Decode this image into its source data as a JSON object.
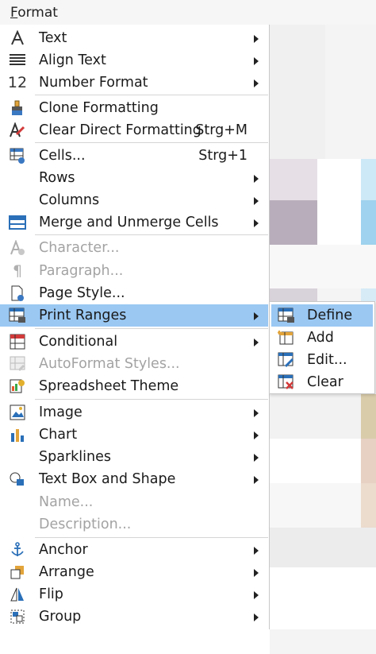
{
  "menubar": {
    "title": "Format",
    "mnemonic_first": "F",
    "mnemonic_rest": "ormat"
  },
  "menu": {
    "items": [
      {
        "label": "Text",
        "icon": "text-A-icon",
        "arrow": true
      },
      {
        "label": "Align Text",
        "icon": "align-lines-icon",
        "arrow": true
      },
      {
        "label": "Number Format",
        "icon": "number-12-icon",
        "arrow": true
      },
      {
        "label": "Clone Formatting",
        "icon": "paintbrush-icon"
      },
      {
        "label": "Clear Direct Formatting",
        "icon": "clear-format-icon",
        "shortcut": "Strg+M"
      },
      {
        "label": "Cells...",
        "icon": "cells-icon",
        "shortcut": "Strg+1"
      },
      {
        "label": "Rows",
        "arrow": true
      },
      {
        "label": "Columns",
        "arrow": true
      },
      {
        "label": "Merge and Unmerge Cells",
        "icon": "merge-cells-icon",
        "arrow": true
      },
      {
        "label": "Character...",
        "icon": "character-icon",
        "disabled": true
      },
      {
        "label": "Paragraph...",
        "icon": "paragraph-icon",
        "disabled": true
      },
      {
        "label": "Page Style...",
        "icon": "page-style-icon"
      },
      {
        "label": "Print Ranges",
        "icon": "print-ranges-icon",
        "arrow": true,
        "highlight": true
      },
      {
        "label": "Conditional",
        "icon": "conditional-icon",
        "arrow": true
      },
      {
        "label": "AutoFormat Styles...",
        "icon": "autoformat-icon",
        "disabled": true
      },
      {
        "label": "Spreadsheet Theme",
        "icon": "theme-icon"
      },
      {
        "label": "Image",
        "icon": "image-icon",
        "arrow": true
      },
      {
        "label": "Chart",
        "icon": "chart-icon",
        "arrow": true
      },
      {
        "label": "Sparklines",
        "arrow": true
      },
      {
        "label": "Text Box and Shape",
        "icon": "shape-icon",
        "arrow": true
      },
      {
        "label": "Name...",
        "disabled": true
      },
      {
        "label": "Description...",
        "disabled": true
      },
      {
        "label": "Anchor",
        "icon": "anchor-icon",
        "arrow": true
      },
      {
        "label": "Arrange",
        "icon": "arrange-icon",
        "arrow": true
      },
      {
        "label": "Flip",
        "icon": "flip-icon",
        "arrow": true
      },
      {
        "label": "Group",
        "icon": "group-icon",
        "arrow": true
      }
    ]
  },
  "submenu": {
    "items": [
      {
        "label": "Define",
        "icon": "define-range-icon",
        "highlight": true
      },
      {
        "label": "Add",
        "icon": "add-range-icon"
      },
      {
        "label": "Edit...",
        "icon": "edit-range-icon"
      },
      {
        "label": "Clear",
        "icon": "clear-range-icon"
      }
    ]
  },
  "colors": {
    "highlight": "#9ac8f3",
    "disabled": "#a3a3a3",
    "accent_blue": "#2a6fb8"
  }
}
